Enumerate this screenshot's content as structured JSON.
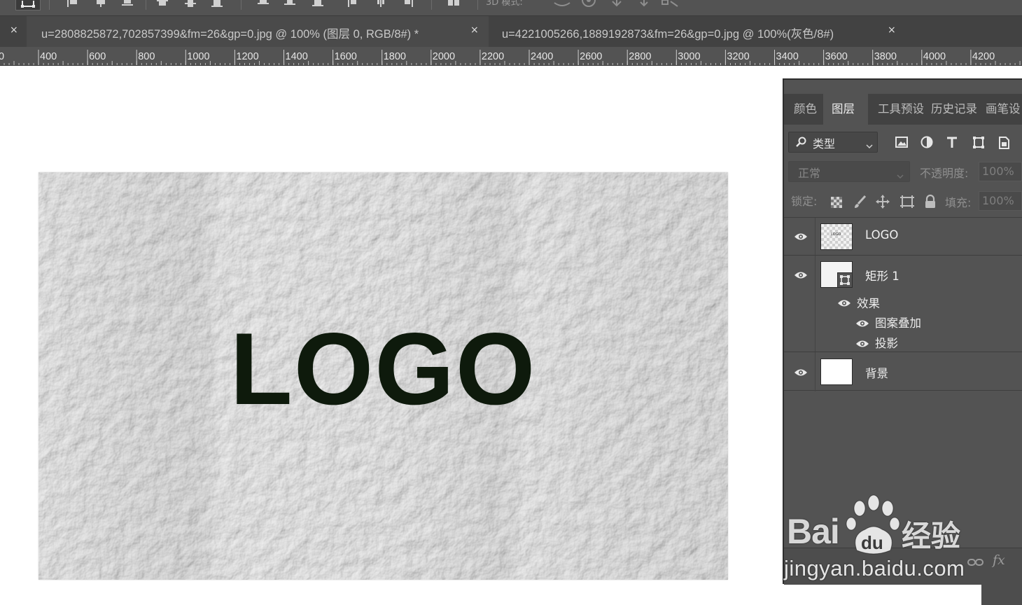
{
  "option_bar": {
    "partial_text": "3D 模式:"
  },
  "tabs": [
    {
      "title": "u=2808825872,702857399&fm=26&gp=0.jpg @ 100% (图层 0, RGB/8#) *",
      "close": "×",
      "active": true
    },
    {
      "title": "u=4221005266,1889192873&fm=26&gp=0.jpg @ 100%(灰色/8#)",
      "close": "×",
      "active": false
    }
  ],
  "tab_left_close": "×",
  "ruler": {
    "labels": [
      "0",
      "400",
      "600",
      "800",
      "1000",
      "1200",
      "1400",
      "1600",
      "1800",
      "2000",
      "2200",
      "2400",
      "2600",
      "2800",
      "3000",
      "3200",
      "3400",
      "3600",
      "3800",
      "4000",
      "4200"
    ]
  },
  "canvas": {
    "logo_text": "LOGO",
    "background_color": "#dcdcdc",
    "text_color": "#0e1a0c"
  },
  "panel": {
    "tabs": [
      "颜色",
      "图层",
      "工具预设",
      "历史记录",
      "画笔设"
    ],
    "active_tab": "图层",
    "filter": {
      "label": "类型",
      "search_icon": "search-icon"
    },
    "filter_icons": [
      "image-filter-icon",
      "adjustment-filter-icon",
      "type-filter-icon",
      "shape-filter-icon",
      "smart-object-filter-icon"
    ],
    "blend_mode": "正常",
    "opacity_label": "不透明度:",
    "opacity_value": "100%",
    "lock_label": "锁定:",
    "lock_icons": [
      "lock-transparent-icon",
      "lock-brush-icon",
      "lock-move-icon",
      "lock-artboard-icon",
      "lock-all-icon"
    ],
    "fill_label": "填充:",
    "fill_value": "100%",
    "layers": [
      {
        "name": "LOGO",
        "visible": true,
        "thumb": "transparent-with-text"
      },
      {
        "name": "矩形 1",
        "visible": true,
        "thumb": "shape",
        "effects_label": "效果",
        "effects": [
          "图案叠加",
          "投影"
        ]
      },
      {
        "name": "背景",
        "visible": true,
        "thumb": "white"
      }
    ],
    "footer_icons": [
      "link-icon",
      "fx-icon"
    ],
    "fx_label": "fx"
  },
  "watermark": {
    "brand_left": "Bai",
    "brand_mid": "du",
    "brand_right": "经验",
    "url": "jingyan.baidu.com"
  }
}
